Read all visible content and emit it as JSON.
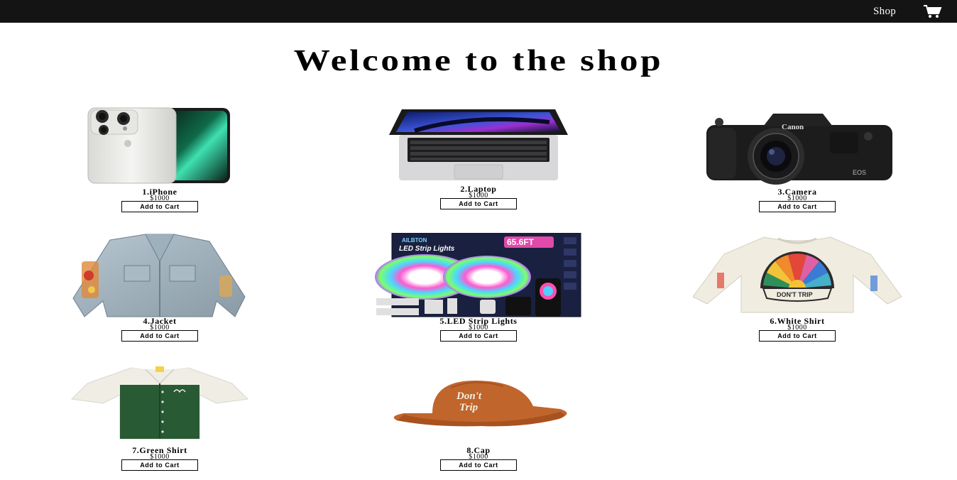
{
  "nav": {
    "shop_label": "Shop",
    "cart_icon": "cart-icon"
  },
  "page": {
    "title": "Welcome to the shop"
  },
  "products": [
    {
      "name": "1.iPhone",
      "price": "$1000",
      "button": "Add to Cart",
      "image": "iphone-image"
    },
    {
      "name": "2.Laptop",
      "price": "$1000",
      "button": "Add to Cart",
      "image": "laptop-image"
    },
    {
      "name": "3.Camera",
      "price": "$1000",
      "button": "Add to Cart",
      "image": "camera-image"
    },
    {
      "name": "4.Jacket",
      "price": "$1000",
      "button": "Add to Cart",
      "image": "jacket-image"
    },
    {
      "name": "5.LED Strip Lights",
      "price": "$1000",
      "button": "Add to Cart",
      "image": "led-strip-image"
    },
    {
      "name": "6.White Shirt",
      "price": "$1000",
      "button": "Add to Cart",
      "image": "white-shirt-image"
    },
    {
      "name": "7.Green Shirt",
      "price": "$1000",
      "button": "Add to Cart",
      "image": "green-shirt-image"
    },
    {
      "name": "8.Cap",
      "price": "$1000",
      "button": "Add to Cart",
      "image": "cap-image"
    }
  ],
  "images": {
    "led_brand": "AILBTON",
    "led_title": "LED Strip Lights",
    "led_length": "65.6FT",
    "camera_brand": "Canon",
    "camera_model": "EOS",
    "shirt_print": "DON'T TRIP",
    "cap_print_1": "Don't",
    "cap_print_2": "Trip"
  }
}
